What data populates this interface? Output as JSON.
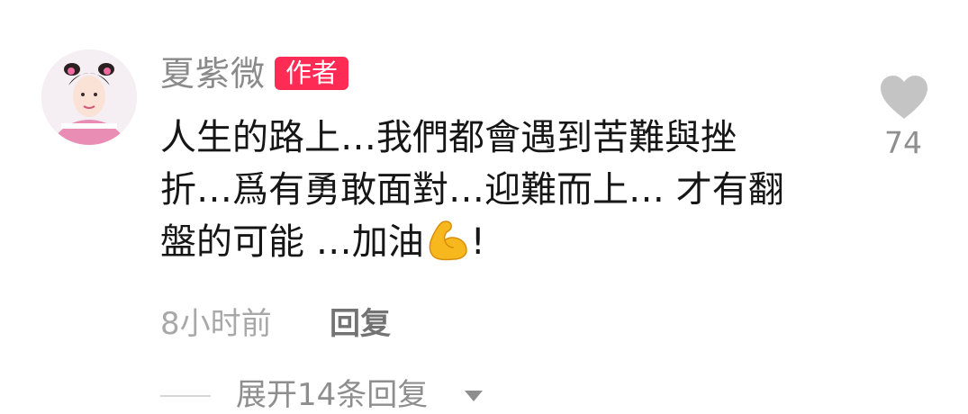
{
  "comment": {
    "author": {
      "name": "夏紫微",
      "badge": "作者"
    },
    "text_lines": [
      "人生的路上…我們都會遇到苦難與挫",
      "折…爲有勇敢面對…迎難而上… 才有翻",
      "盤的可能 …加油"
    ],
    "text_tail": "!",
    "emoji": "flexed-biceps",
    "likes": "74",
    "timestamp": "8小时前",
    "reply_label": "回复",
    "expand_replies_label": "展开14条回复"
  },
  "colors": {
    "badge_bg": "#fe2c55",
    "heart": "#c4c4c4",
    "username": "#8a8a8a",
    "comment_text": "#161616"
  }
}
